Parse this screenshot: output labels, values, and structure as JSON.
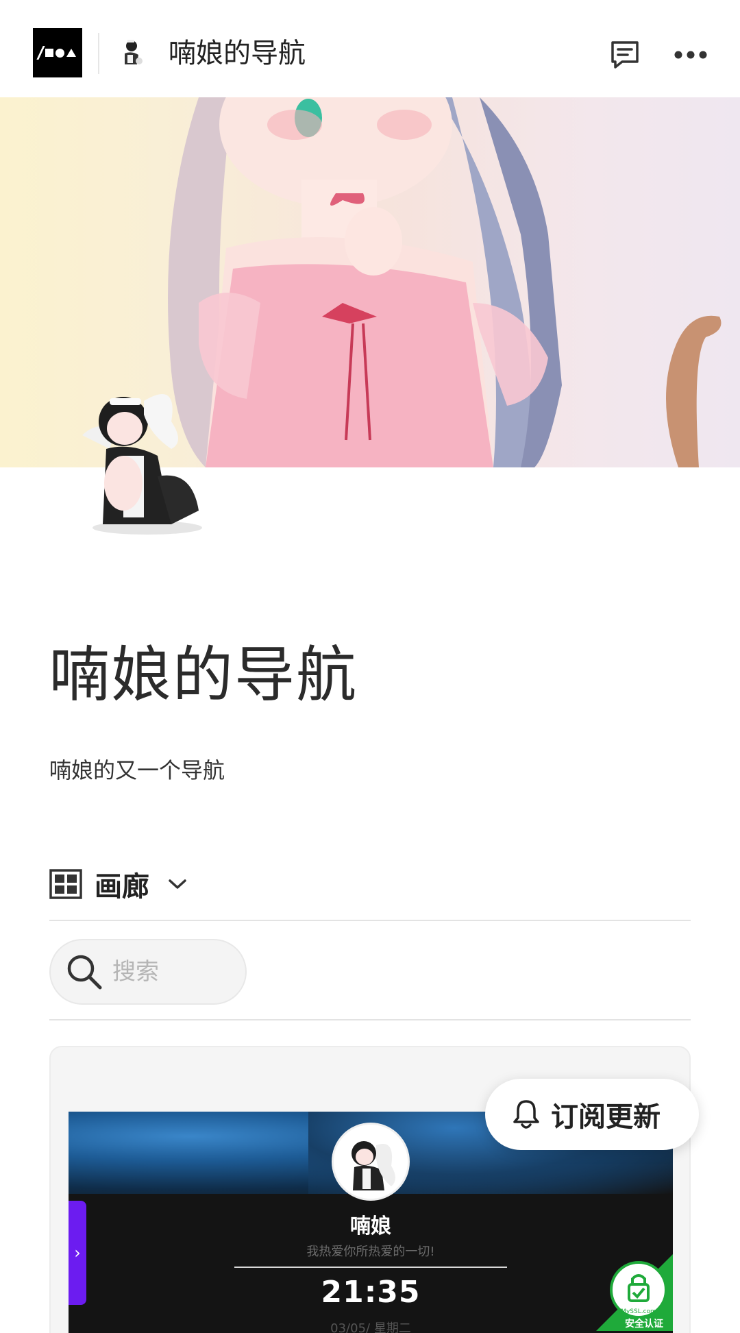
{
  "header": {
    "site_title": "喃娘的导航"
  },
  "page": {
    "title": "喃娘的导航",
    "subtitle": "喃娘的又一个导航"
  },
  "view": {
    "label": "画廊"
  },
  "search": {
    "placeholder": "搜索"
  },
  "preview": {
    "name": "喃娘",
    "motto": "我热爱你所热爱的一切!",
    "time": "21:35",
    "date": "03/05/ 星期二",
    "tab_arrow": "›"
  },
  "ssl_badge": {
    "brand": "MySSL.com",
    "label": "安全认证"
  },
  "subscribe": {
    "label": "订阅更新"
  },
  "colors": {
    "accent_purple": "#6c1cf0",
    "ssl_green": "#1faa3a"
  }
}
